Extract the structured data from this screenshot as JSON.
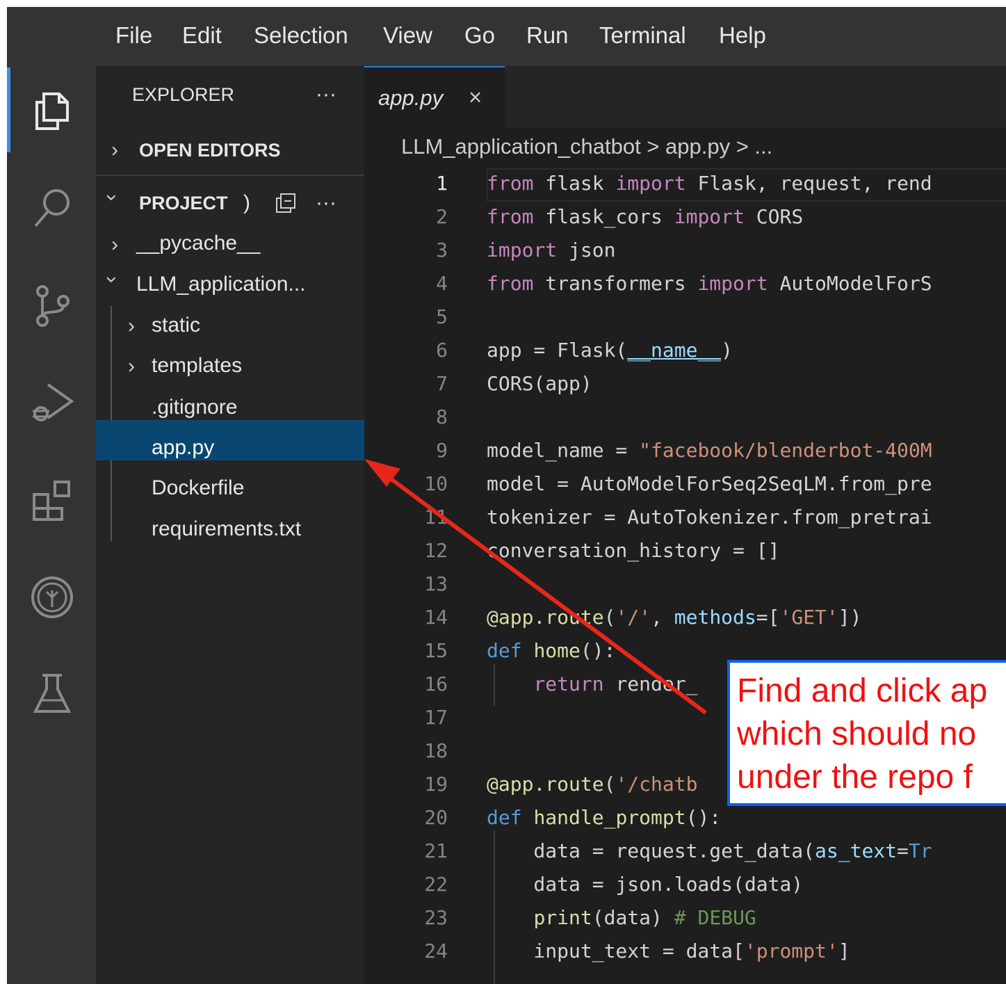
{
  "menu": [
    "File",
    "Edit",
    "Selection",
    "View",
    "Go",
    "Run",
    "Terminal",
    "Help"
  ],
  "activity_icons": [
    "explorer-icon",
    "search-icon",
    "source-control-icon",
    "run-debug-icon",
    "extensions-icon",
    "tree-icon",
    "testing-icon"
  ],
  "sidebar": {
    "title": "EXPLORER",
    "more": "···",
    "open_editors": "OPEN EDITORS",
    "project": "PROJECT",
    "project_suffix": ")",
    "items": {
      "pycache": "__pycache__",
      "llm_folder": "LLM_application...",
      "static": "static",
      "templates": "templates",
      "gitignore": ".gitignore",
      "app_py": "app.py",
      "dockerfile": "Dockerfile",
      "requirements": "requirements.txt"
    }
  },
  "editor": {
    "tab_label": "app.py",
    "tab_close": "×",
    "breadcrumb": "LLM_application_chatbot  >  app.py  >  ..."
  },
  "code_lines": [
    {
      "n": "1",
      "text": "from flask import Flask, request, rend"
    },
    {
      "n": "2",
      "text": "from flask_cors import CORS"
    },
    {
      "n": "3",
      "text": "import json"
    },
    {
      "n": "4",
      "text": "from transformers import AutoModelForS"
    },
    {
      "n": "5",
      "text": ""
    },
    {
      "n": "6",
      "text": "app = Flask(__name__)"
    },
    {
      "n": "7",
      "text": "CORS(app)"
    },
    {
      "n": "8",
      "text": ""
    },
    {
      "n": "9",
      "text": "model_name = \"facebook/blenderbot-400M"
    },
    {
      "n": "10",
      "text": "model = AutoModelForSeq2SeqLM.from_pre"
    },
    {
      "n": "11",
      "text": "tokenizer = AutoTokenizer.from_pretrai"
    },
    {
      "n": "12",
      "text": "conversation_history = []"
    },
    {
      "n": "13",
      "text": ""
    },
    {
      "n": "14",
      "text": "@app.route('/', methods=['GET'])"
    },
    {
      "n": "15",
      "text": "def home():"
    },
    {
      "n": "16",
      "text": "    return render_"
    },
    {
      "n": "17",
      "text": ""
    },
    {
      "n": "18",
      "text": ""
    },
    {
      "n": "19",
      "text": "@app.route('/chatb"
    },
    {
      "n": "20",
      "text": "def handle_prompt():"
    },
    {
      "n": "21",
      "text": "    data = request.get_data(as_text=Tr"
    },
    {
      "n": "22",
      "text": "    data = json.loads(data)"
    },
    {
      "n": "23",
      "text": "    print(data) # DEBUG"
    },
    {
      "n": "24",
      "text": "    input_text = data['prompt']"
    }
  ],
  "annotation": {
    "line1": "Find and click ap",
    "line2": "which should no",
    "line3": "under the repo f"
  },
  "colors": {
    "selection": "#094771",
    "arrow": "#e8261a",
    "annotation_border": "#1060f0",
    "annotation_text": "#f01010"
  }
}
